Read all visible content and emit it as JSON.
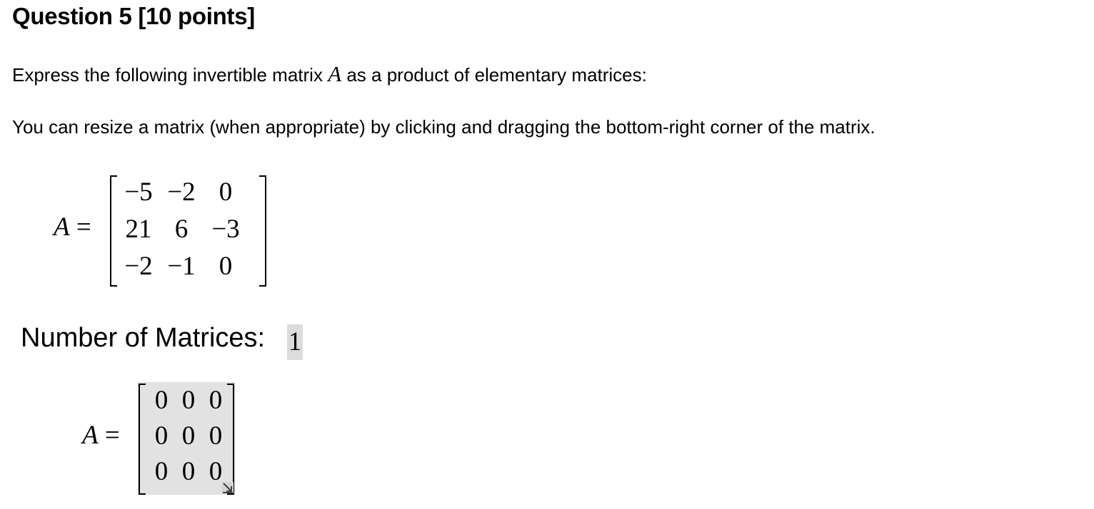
{
  "question": {
    "title": "Question 5 [10 points]",
    "prompt_before": "Express the following invertible matrix ",
    "prompt_var": "A",
    "prompt_after": " as a product of elementary matrices:",
    "hint": "You can resize a matrix (when appropriate) by clicking and dragging the bottom-right corner of the matrix."
  },
  "given_matrix": {
    "var": "A",
    "equals": "=",
    "rows": [
      [
        "−5",
        "−2",
        "0"
      ],
      [
        "21",
        "6",
        "−3"
      ],
      [
        "−2",
        "−1",
        "0"
      ]
    ]
  },
  "number_of_matrices": {
    "label": "Number of Matrices:",
    "value": "1"
  },
  "answer": {
    "var": "A",
    "equals": "=",
    "rows": [
      [
        "0",
        "0",
        "0"
      ],
      [
        "0",
        "0",
        "0"
      ],
      [
        "0",
        "0",
        "0"
      ]
    ],
    "resize_icon": "resize-corner-icon"
  }
}
